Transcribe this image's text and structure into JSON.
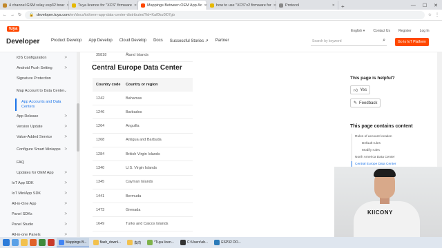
{
  "browser": {
    "tabs": [
      {
        "label": "4 channel GSM relay esp32 boar",
        "color": "#c1882c",
        "active": false
      },
      {
        "label": "Tuya licence for \"XCS\" firmware",
        "color": "#e6b800",
        "active": false
      },
      {
        "label": "Mappings Between OEM App Ac",
        "color": "#ff4800",
        "active": true
      },
      {
        "label": "how to use \"XCS\"v2 firmware for",
        "color": "#e6b800",
        "active": false
      },
      {
        "label": "Protocol",
        "color": "#888888",
        "active": false
      }
    ],
    "new_tab": "+",
    "url_host": "developer.tuya.com",
    "url_path": "/en/docs/iot/oem-app-data-center-distributed?id=Kaf0ku0l07gb"
  },
  "site": {
    "logo_badge": "tuya",
    "logo_text": "Developer",
    "nav": [
      "Product Develop",
      "App Develop",
      "Cloud Develop",
      "Docs",
      "Successful Stories ↗",
      "Partner"
    ],
    "toplinks": [
      "English ▾",
      "Contact Us",
      "Register",
      "Log In"
    ],
    "search_placeholder": "Search by keyword",
    "cta": "Go to IoT Platform"
  },
  "sidebar": {
    "items": [
      {
        "label": "iOS Configuration",
        "chev": ">",
        "cls": "sb-item"
      },
      {
        "label": "Android Push Setting",
        "chev": ">",
        "cls": "sb-item"
      },
      {
        "label": "Signature Protection",
        "chev": "",
        "cls": "sb-item"
      },
      {
        "label": "Map Account to Data Center",
        "chev": "⌄",
        "cls": "sb-item multi"
      },
      {
        "label": "App Accounts and Data Centers",
        "chev": "",
        "cls": "sb-item active"
      },
      {
        "label": "App Release",
        "chev": ">",
        "cls": "sb-item"
      },
      {
        "label": "Version Update",
        "chev": ">",
        "cls": "sb-item"
      },
      {
        "label": "Value-Added Service",
        "chev": ">",
        "cls": "sb-item"
      },
      {
        "label": "Configure Smart Miniapps",
        "chev": ">",
        "cls": "sb-item multi"
      },
      {
        "label": "FAQ",
        "chev": "",
        "cls": "sb-item"
      },
      {
        "label": "Updates for OEM App",
        "chev": ">",
        "cls": "sb-item"
      },
      {
        "label": "IoT App SDK",
        "chev": ">",
        "cls": "sb-item lvl1"
      },
      {
        "label": "IoT MiniApp SDK",
        "chev": ">",
        "cls": "sb-item lvl1"
      },
      {
        "label": "All-in-One App",
        "chev": ">",
        "cls": "sb-item lvl1"
      },
      {
        "label": "Panel SDKs",
        "chev": ">",
        "cls": "sb-item lvl1"
      },
      {
        "label": "Panel Studio",
        "chev": ">",
        "cls": "sb-item lvl1"
      },
      {
        "label": "All-in-one Panels",
        "chev": ">",
        "cls": "sb-item lvl1"
      }
    ]
  },
  "main": {
    "prev_row": {
      "code": "35818",
      "region": "Åland Islands"
    },
    "heading": "Central Europe Data Center",
    "columns": [
      "Country code",
      "Country or region"
    ],
    "rows": [
      {
        "code": "1242",
        "region": "Bahamas"
      },
      {
        "code": "1246",
        "region": "Barbados"
      },
      {
        "code": "1264",
        "region": "Anguilla"
      },
      {
        "code": "1268",
        "region": "Antigua and Barbuda"
      },
      {
        "code": "1284",
        "region": "British Virgin Islands"
      },
      {
        "code": "1340",
        "region": "U.S. Virgin Islands"
      },
      {
        "code": "1345",
        "region": "Cayman Islands"
      },
      {
        "code": "1441",
        "region": "Bermuda"
      },
      {
        "code": "1473",
        "region": "Grenada"
      },
      {
        "code": "1649",
        "region": "Turks and Caicos Islands"
      }
    ]
  },
  "right": {
    "helpful_title": "This page is helpful?",
    "yes": "Yes",
    "feedback": "Feedback",
    "toc_title": "This page contains content",
    "toc": [
      {
        "label": "Rules of account location",
        "cls": ""
      },
      {
        "label": "Default rules",
        "cls": "sub"
      },
      {
        "label": "Modify rules",
        "cls": "sub"
      },
      {
        "label": "North America Data Center",
        "cls": ""
      },
      {
        "label": "Central Europe Data Center",
        "cls": "cur"
      }
    ]
  },
  "webcam": {
    "shirt_text": "KIICONY"
  },
  "taskbar": {
    "apps": [
      {
        "label": "Mappings B...",
        "color": "#4285f4",
        "on": true
      },
      {
        "label": "flash_downl...",
        "color": "#f2c14e",
        "on": false
      },
      {
        "label": "去向",
        "color": "#f2c14e",
        "on": false
      },
      {
        "label": "*Tuya licen...",
        "color": "#7fb24a",
        "on": false
      },
      {
        "label": "C:\\Users\\sb...",
        "color": "#333333",
        "on": false
      },
      {
        "label": "ESP32 DO...",
        "color": "#2b7bb9",
        "on": false
      }
    ]
  },
  "colors": {
    "brand": "#ff4800",
    "link": "#1a73e8"
  }
}
